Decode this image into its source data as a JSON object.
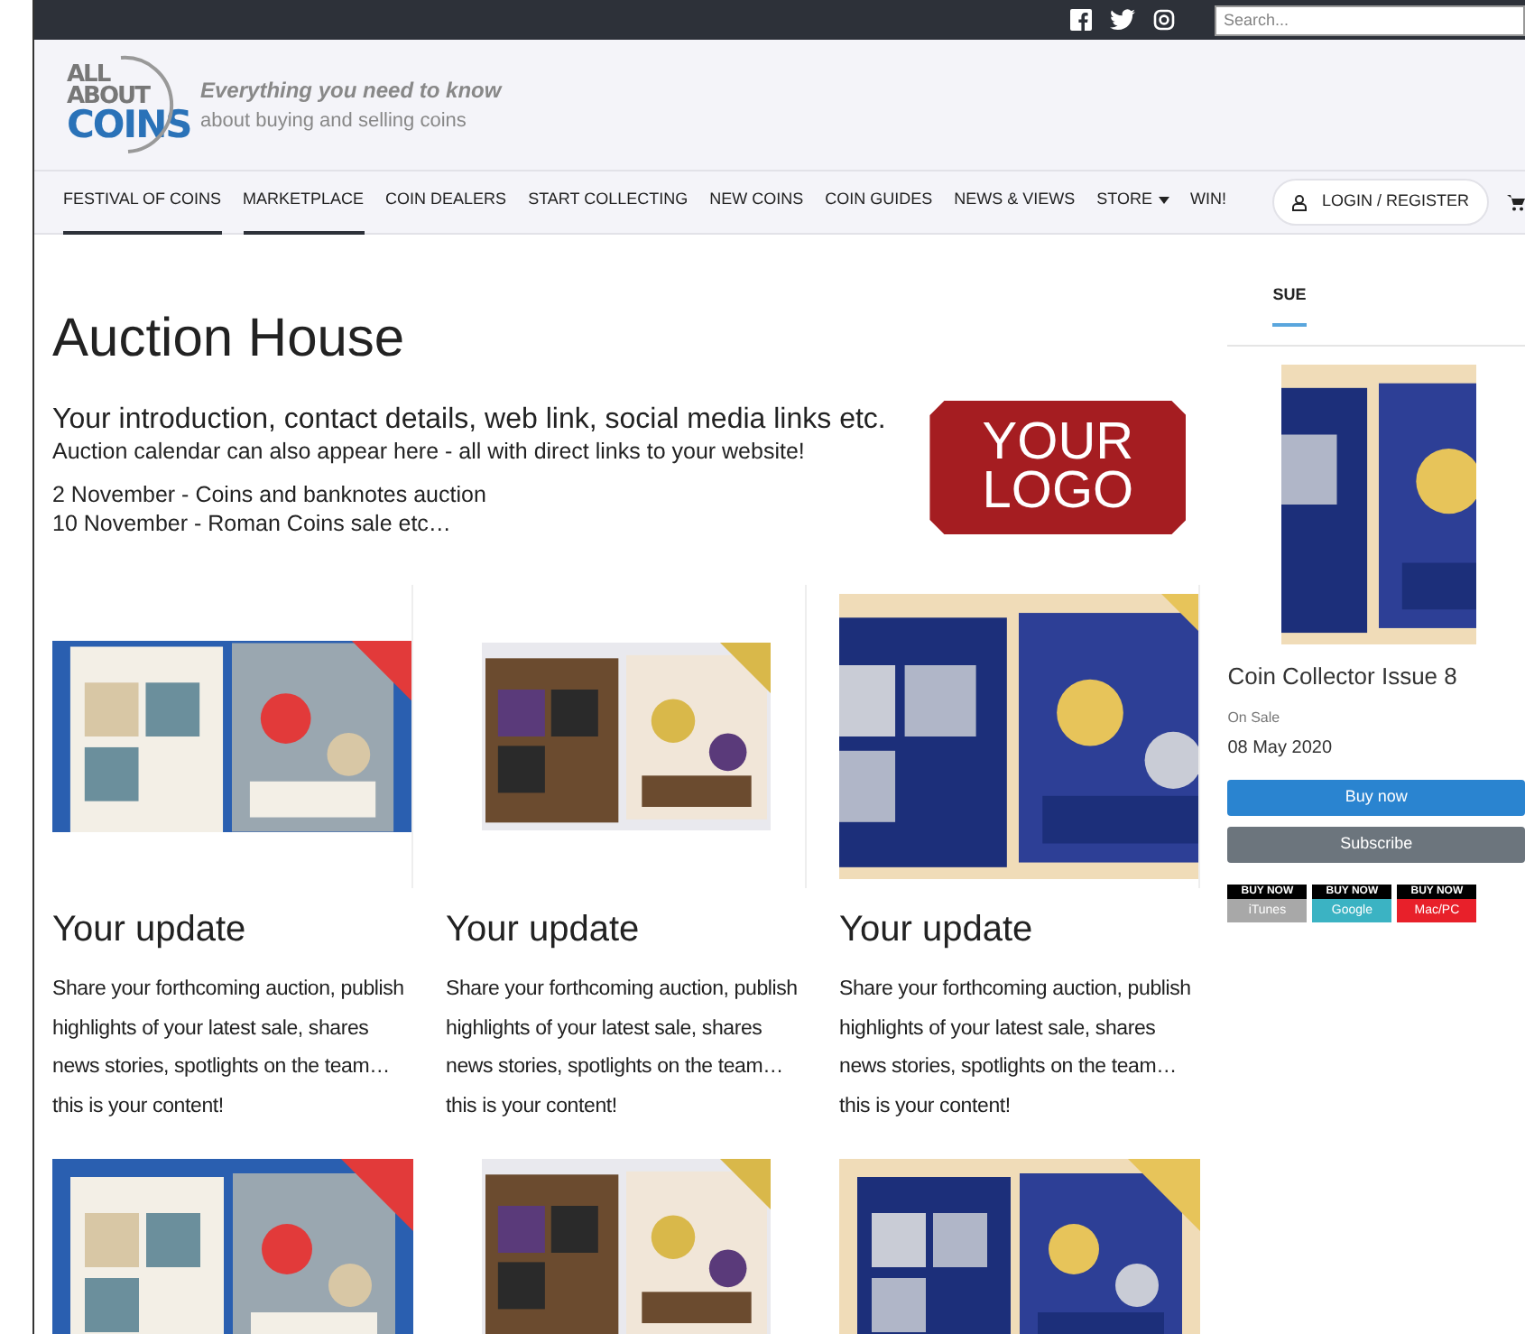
{
  "top_bar": {
    "search": {
      "placeholder": "Search..."
    }
  },
  "header": {
    "logo": {
      "line_1": "ALL",
      "line_2": "ABOUT",
      "line_3": "COINS"
    },
    "tagline": "Everything you need to know",
    "subtitle": "about buying and selling coins"
  },
  "nav": {
    "items": [
      {
        "label": "FESTIVAL OF COINS",
        "underlined": true,
        "dropdown": false
      },
      {
        "label": "MARKETPLACE",
        "underlined": true,
        "dropdown": false
      },
      {
        "label": "COIN DEALERS",
        "underlined": false,
        "dropdown": false
      },
      {
        "label": "START COLLECTING",
        "underlined": false,
        "dropdown": false
      },
      {
        "label": "NEW COINS",
        "underlined": false,
        "dropdown": false
      },
      {
        "label": "COIN GUIDES",
        "underlined": false,
        "dropdown": false
      },
      {
        "label": "NEWS & VIEWS",
        "underlined": false,
        "dropdown": false
      },
      {
        "label": "STORE",
        "underlined": false,
        "dropdown": true
      },
      {
        "label": "WIN!",
        "underlined": false,
        "dropdown": false
      }
    ],
    "login": "LOGIN / REGISTER"
  },
  "main": {
    "title": "Auction House",
    "intro": "Your introduction, contact details, web link, social media links etc.",
    "note": "Auction calendar can also appear here - all with direct links to your website!",
    "events": [
      "2 November - Coins and banknotes auction",
      "10 November - Roman Coins sale etc…"
    ],
    "logo_badge": {
      "line_1": "YOUR",
      "line_2": "LOGO"
    },
    "cards": [
      {
        "kind": "picture",
        "title": "Your update",
        "text": "Share your forthcoming auction, publish highlights of your latest sale, shares news stories, spotlights on the team… this is your content!"
      },
      {
        "kind": "picture",
        "title": "Your update",
        "text": "Share your forthcoming auction, publish highlights of your latest sale, shares news stories, spotlights on the team… this is your content!"
      },
      {
        "kind": "picture",
        "title": "Your update",
        "text": "Share your forthcoming auction, publish highlights of your latest sale, shares news stories, spotlights on the team… this is your content!"
      }
    ]
  },
  "sidebar": {
    "tab": "SUE",
    "issue_title": "Coin Collector Issue 8",
    "on_sale_label": "On Sale",
    "date": "08 May 2020",
    "buttons": [
      {
        "label": "Buy now",
        "kind": "primary"
      },
      {
        "label": "Subscribe",
        "kind": "secondary"
      }
    ],
    "badges": [
      {
        "top": "BUY NOW",
        "label": "iTunes",
        "color": "#a8a8a8"
      },
      {
        "top": "BUY NOW",
        "label": "Google",
        "color": "#3bb3c3"
      },
      {
        "top": "BUY NOW",
        "label": "Mac/PC",
        "color": "#e8202a"
      }
    ]
  }
}
